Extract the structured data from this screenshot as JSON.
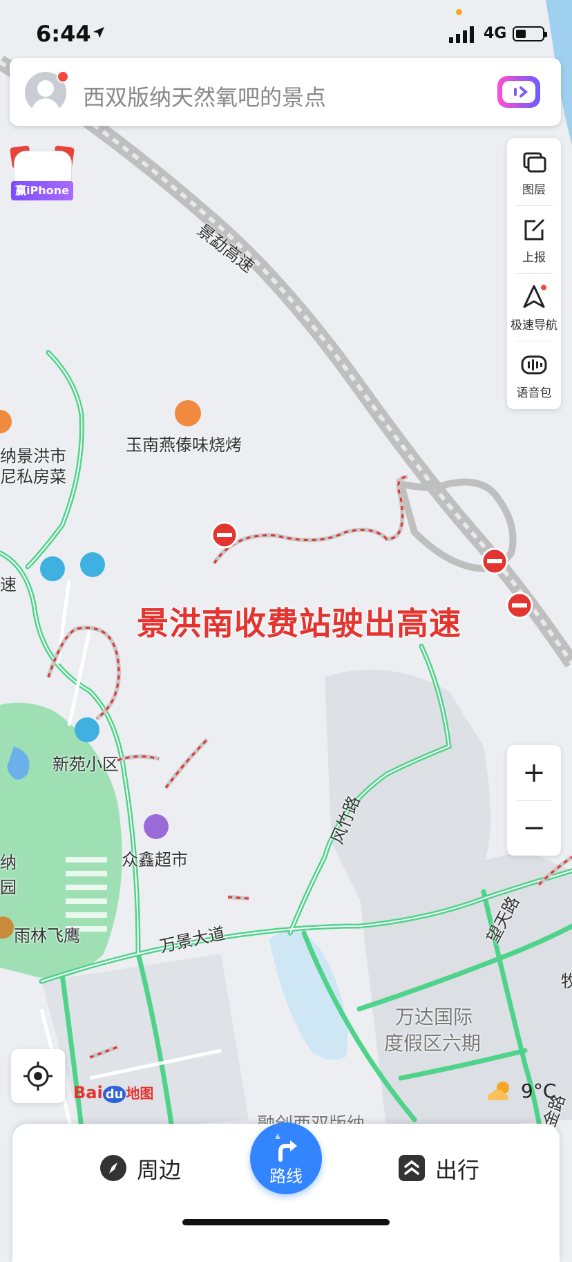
{
  "status": {
    "time": "6:44",
    "network": "4G"
  },
  "search": {
    "placeholder": "西双版纳天然氧吧的景点"
  },
  "promo": {
    "tag": "赢iPhone"
  },
  "tools": [
    {
      "label": "图层",
      "icon": "layers-icon"
    },
    {
      "label": "上报",
      "icon": "report-icon"
    },
    {
      "label": "极速导航",
      "icon": "navigation-icon"
    },
    {
      "label": "语音包",
      "icon": "voice-pack-icon"
    }
  ],
  "zoom": {
    "in": "+",
    "out": "−"
  },
  "map": {
    "labels": {
      "highway": "景勐高速",
      "restaurant1": "玉南燕傣味烧烤",
      "restaurant2a": "纳景洪市",
      "restaurant2b": "尼私房菜",
      "edge_left": "速",
      "community": "新苑小区",
      "supermarket": "众鑫超市",
      "rainforest": "雨林飞鹰",
      "wanjing": "万景大道",
      "fengzhu": "风竹路",
      "wangtian": "望天路",
      "wanda1": "万达国际",
      "wanda2": "度假区六期",
      "bottom_partial": "融创西双版纳",
      "right_partial": "牧",
      "jinlu": "紫金路",
      "left_partial1": "纳",
      "left_partial2": "园"
    },
    "annotation": "景洪南收费站驶出高速"
  },
  "brand": {
    "baidu": "Bai",
    "du": "du",
    "ditu": "地图"
  },
  "weather": {
    "temp": "9°C"
  },
  "bottom": {
    "nearby": "周边",
    "route": "路线",
    "travel": "出行"
  },
  "colors": {
    "accent": "#3385ff",
    "road_green": "#4fd38a",
    "closure_red": "#e3342f",
    "park": "#9ee0b4"
  }
}
